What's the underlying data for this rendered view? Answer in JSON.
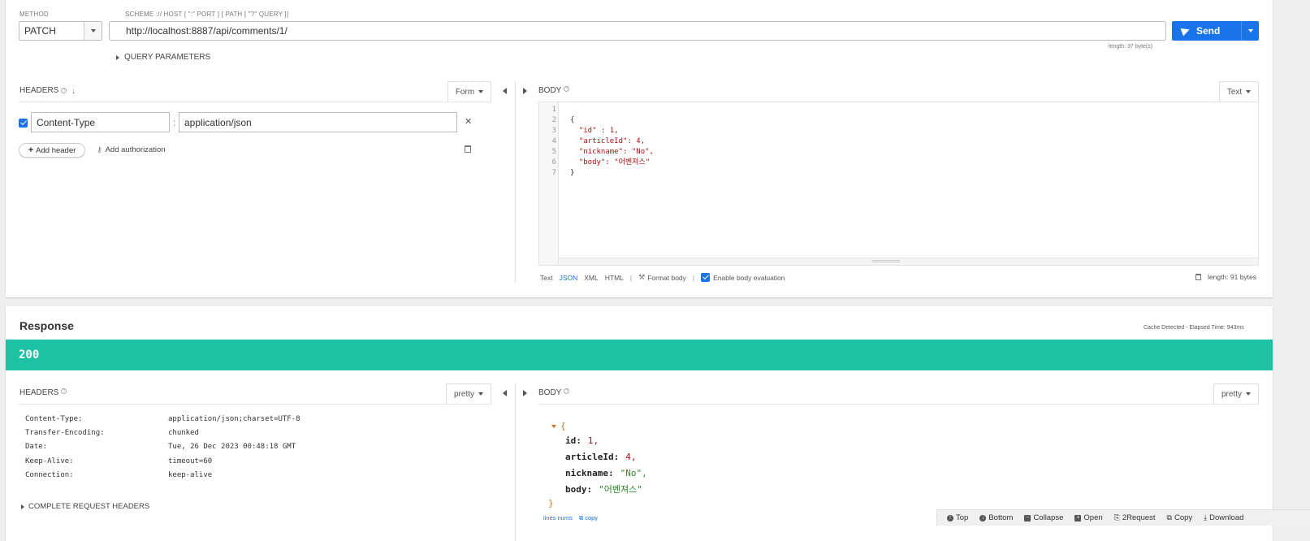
{
  "request": {
    "method_label": "METHOD",
    "method": "PATCH",
    "url_label": "SCHEME :// HOST [ \":\" PORT ] [ PATH [ \"?\" QUERY ]]",
    "url": "http://localhost:8887/api/comments/1/",
    "send_label": "Send",
    "url_length": "length: 37 byte(s)",
    "query_params_label": "QUERY PARAMETERS",
    "headers": {
      "title": "HEADERS",
      "mode": "Form",
      "rows": [
        {
          "name": "Content-Type",
          "value": "application/json",
          "enabled": true
        }
      ],
      "add_header": "Add header",
      "add_authorization": "Add authorization"
    },
    "body": {
      "title": "BODY",
      "mode": "Text",
      "lines": [
        {
          "num": "1",
          "text": ""
        },
        {
          "num": "2",
          "text": "{"
        },
        {
          "num": "3",
          "text": "  \"id\" : 1,"
        },
        {
          "num": "4",
          "text": "  \"articleId\": 4,"
        },
        {
          "num": "5",
          "text": "  \"nickname\": \"No\","
        },
        {
          "num": "6",
          "text": "  \"body\": \"어벤져스\""
        },
        {
          "num": "7",
          "text": "}"
        }
      ],
      "formats": [
        "Text",
        "JSON",
        "XML",
        "HTML"
      ],
      "active_format": "JSON",
      "format_body": "Format body",
      "enable_eval": "Enable body evaluation",
      "length": "length: 91 bytes"
    }
  },
  "response": {
    "title": "Response",
    "meta": "Cache Detected - Elapsed Time: 943ms",
    "status": "200",
    "status_color": "#1cc2a3",
    "headers": {
      "title": "HEADERS",
      "mode": "pretty",
      "rows": [
        {
          "key": "Content-Type:",
          "value": "application/json;charset=UTF-8"
        },
        {
          "key": "Transfer-Encoding:",
          "value": "chunked"
        },
        {
          "key": "Date:",
          "value": "Tue, 26 Dec 2023 00:48:18 GMT"
        },
        {
          "key": "Keep-Alive:",
          "value": "timeout=60"
        },
        {
          "key": "Connection:",
          "value": "keep-alive"
        }
      ],
      "complete_label": "COMPLETE REQUEST HEADERS"
    },
    "body": {
      "title": "BODY",
      "mode": "pretty",
      "open_brace": "{",
      "close_brace": "}",
      "fields": [
        {
          "key": "id:",
          "value": "1,",
          "type": "number"
        },
        {
          "key": "articleId:",
          "value": "4,",
          "type": "number"
        },
        {
          "key": "nickname:",
          "value": "\"No\",",
          "type": "string"
        },
        {
          "key": "body:",
          "value": "\"어벤져스\"",
          "type": "string"
        }
      ],
      "lines_nums": "lines nums",
      "copy": "copy"
    },
    "bottom_bar": [
      "Top",
      "Bottom",
      "Collapse",
      "Open",
      "2Request",
      "Copy",
      "Download"
    ]
  },
  "colors": {
    "accent": "#1a73e8",
    "status": "#1cc2a3"
  }
}
